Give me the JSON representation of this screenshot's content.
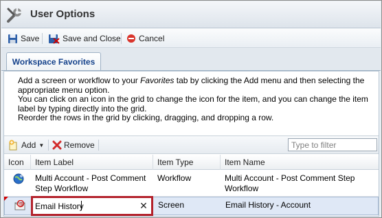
{
  "window": {
    "title": "User Options"
  },
  "toolbar": {
    "save_label": "Save",
    "save_close_label": "Save and Close",
    "cancel_label": "Cancel"
  },
  "tabs": [
    {
      "label": "Workspace Favorites",
      "active": true
    }
  ],
  "instructions": {
    "line1_pre": "Add a screen or workflow to your ",
    "line1_em": "Favorites",
    "line1_post": " tab by clicking the Add menu and then selecting the appropriate menu option.",
    "line2": "You can click on an icon in the grid to change the icon for the item, and you can change the item label by typing directly into the grid.",
    "line3": "Reorder the rows in the grid by clicking, dragging, and dropping a row."
  },
  "grid_toolbar": {
    "add_label": "Add",
    "remove_label": "Remove",
    "filter_placeholder": "Type to filter"
  },
  "grid": {
    "columns": [
      "Icon",
      "Item Label",
      "Item Type",
      "Item Name"
    ],
    "rows": [
      {
        "icon": "globe-icon",
        "label": "Multi Account - Post Comment Step Workflow",
        "type": "Workflow",
        "name": "Multi Account - Post Comment Step Workflow"
      },
      {
        "icon": "email-icon",
        "label": "Email History",
        "type": "Screen",
        "name": "Email History - Account",
        "editing": true
      }
    ]
  },
  "colors": {
    "accent": "#15428b",
    "edit_border": "#b3202a",
    "selected_row": "#dfe8f6"
  }
}
